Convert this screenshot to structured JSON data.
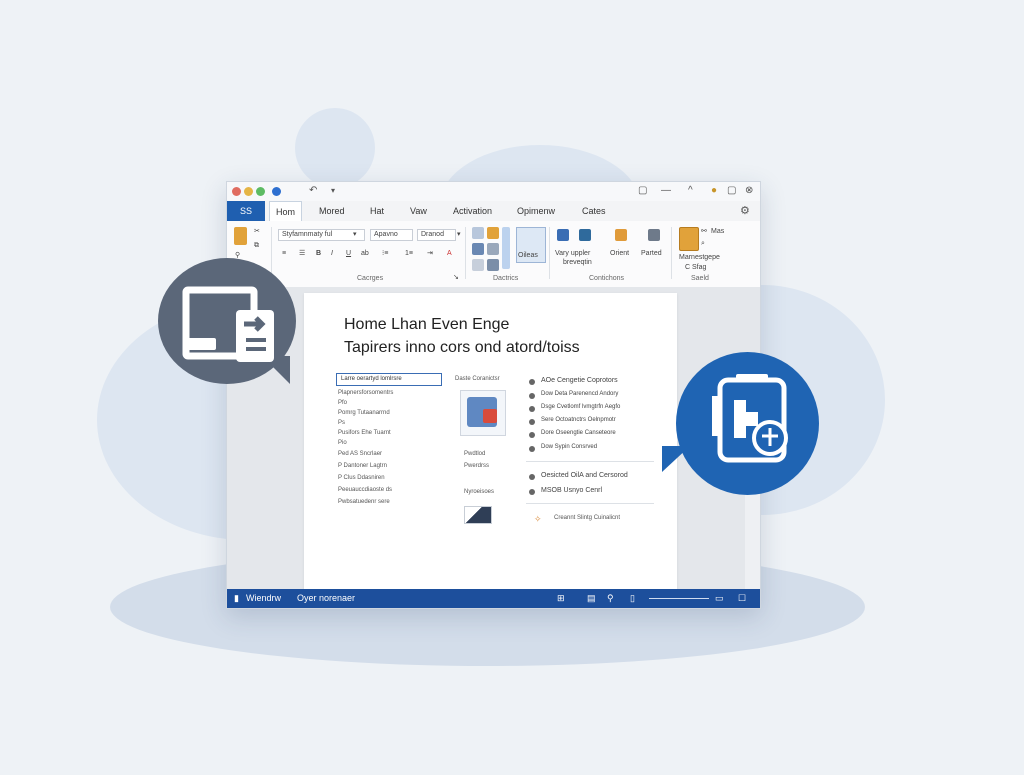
{
  "window": {
    "app_badge": "SS",
    "tabs": [
      "Hom",
      "Mored",
      "Hat",
      "Vaw",
      "Activation",
      "Opimenw",
      "Cates"
    ],
    "active_tab": "Hom"
  },
  "ribbon": {
    "font_box": "Styfamnmaty ful",
    "style_box": "Apavno",
    "style_box_2": "Dranod",
    "group_labels": [
      "Cacrges",
      "Dactrics",
      "Contichons",
      "Saeld"
    ],
    "labels": {
      "vary": "Vary uppler",
      "vary2": "breveqtin",
      "oileas": "Oileas",
      "orient": "Orient",
      "parted": "Parted",
      "mas": "Mas",
      "mamestage": "Marnestgepe",
      "mamestage2": "C Sfag"
    }
  },
  "document": {
    "heading_line1": "Home Lhan Even Enge",
    "heading_line2": "Tapirers inno cors ond atord/toiss",
    "field_value": "Larre oerartyd lomlrsre",
    "left_lines": [
      "Plapnersforsomentrs",
      "Pfo",
      "Pomrg Tutaanarrnd",
      "Ps",
      "Pusifors Ehe Tuarnt",
      "Pio",
      "Ped AS Sncrlaer",
      "P Dantoner Lagtrn",
      "P Clus Ddasniren",
      "Peeuauccdiaoste ds",
      "Pwbsatuedenr sere"
    ],
    "mid_caption": "Daste Coranictsr",
    "mid_items": [
      "Pwdtlod",
      "Pwerdrss",
      "Nyroeisoes"
    ],
    "right_lines": [
      "AOe Cengetie Coprotors",
      "Dow Deta Parenencd Andory",
      "Dsge Cvetlomf lvmgtrfn Aegfo",
      "Sere Octoatnctrs Oelnpmotr",
      "Dore Oseengtie Canseteore",
      "Dow Sypin Consrved"
    ],
    "right_lines_b": [
      "Oesicted OilA and Cersorod",
      "MSOB Usnyo Cenrl"
    ],
    "footer_text": "Creannt Slintg Cuinalicnt"
  },
  "statusbar": {
    "left_label": "Wiendrw",
    "mid_label": "Oyer norenaer"
  },
  "colors": {
    "accent": "#1f5fb0",
    "status_bar": "#1d4f9c",
    "bubble_left": "#5b6779",
    "bubble_right": "#1f64b3"
  }
}
